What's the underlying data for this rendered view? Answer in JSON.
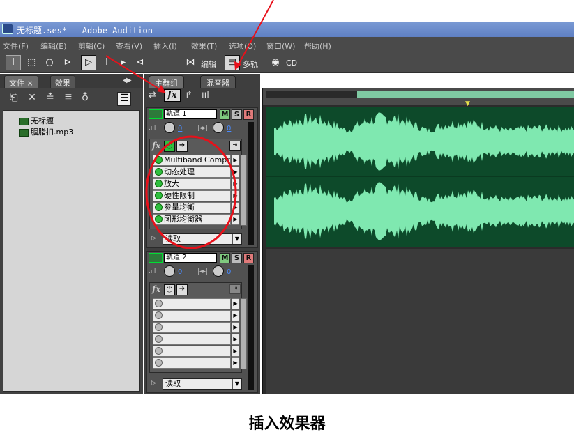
{
  "window": {
    "title": "无标题.ses* - Adobe Audition"
  },
  "menu": [
    "文件(F)",
    "编辑(E)",
    "剪辑(C)",
    "查看(V)",
    "插入(I)",
    "效果(T)",
    "选项(O)",
    "窗口(W)",
    "帮助(H)"
  ],
  "toolbar": {
    "edit_label": "编辑",
    "multitrack_label": "多轨",
    "cd_label": "CD"
  },
  "left_panel": {
    "tabs": [
      "文件",
      "效果"
    ],
    "tab_close": "×",
    "files": [
      "无标题",
      "胭脂扣.mp3"
    ]
  },
  "mixer": {
    "tabs": [
      "主群组",
      "混音器"
    ],
    "tracks": [
      {
        "name": "轨道 1",
        "m": "M",
        "s": "S",
        "r": "R",
        "vol": "0",
        "pan": "0",
        "effects": [
          "Multiband Compr",
          "动态处理",
          "放大",
          "硬性限制",
          "参量均衡",
          "图形均衡器"
        ],
        "read_mode": "读取"
      },
      {
        "name": "轨道 2",
        "m": "M",
        "s": "S",
        "r": "R",
        "vol": "0",
        "pan": "0",
        "effects": [
          "",
          "",
          "",
          "",
          "",
          ""
        ],
        "read_mode": "读取"
      }
    ]
  },
  "annotation": {
    "caption": "插入效果器"
  },
  "colors": {
    "waveform": "#7fe8b0",
    "track_bg": "#0d4a2a",
    "annotation": "#e8101a"
  }
}
